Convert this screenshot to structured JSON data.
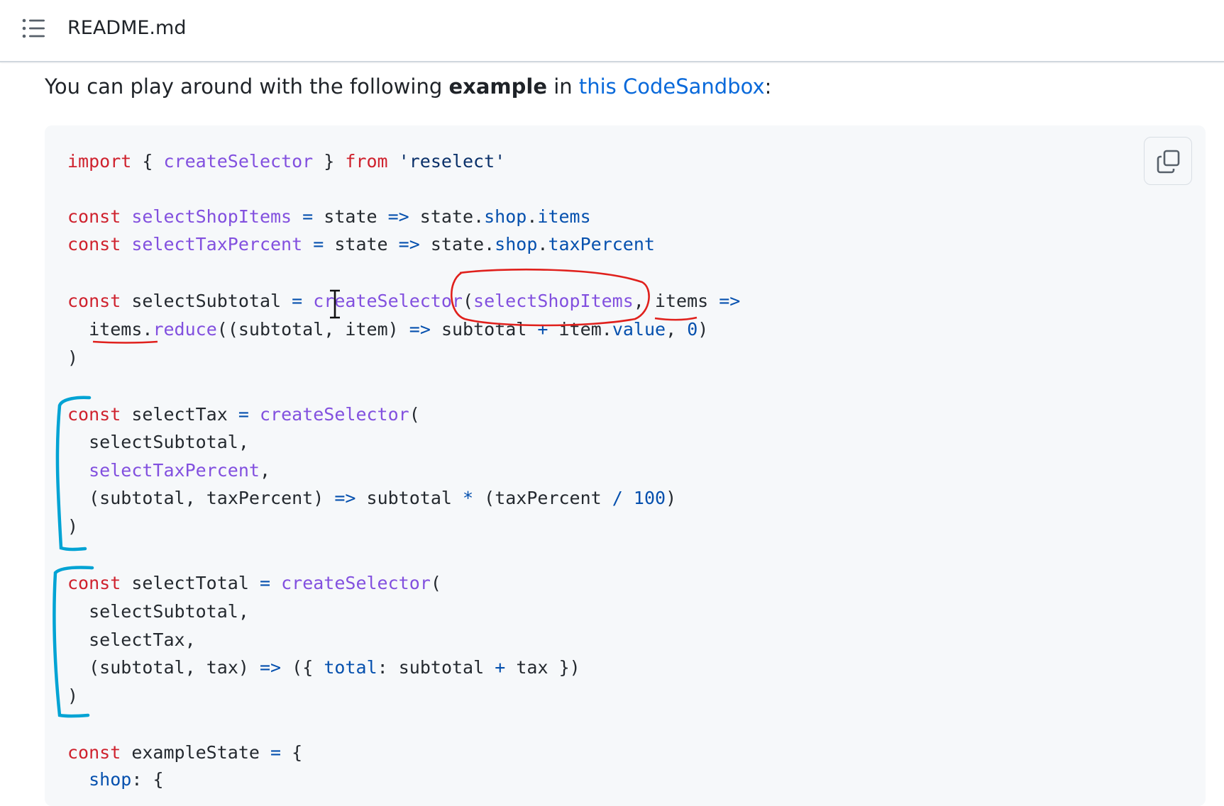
{
  "header": {
    "filename": "README.md",
    "toc_icon": "list-unordered-icon"
  },
  "intro": {
    "text_before": "You can play around with the following ",
    "bold": "example",
    "text_middle": " in ",
    "link": "this CodeSandbox",
    "text_after": ":"
  },
  "code": {
    "copy_icon": "copy-icon",
    "lines": [
      "import { createSelector } from 'reselect'",
      "",
      "const selectShopItems = state => state.shop.items",
      "const selectTaxPercent = state => state.shop.taxPercent",
      "",
      "const selectSubtotal = createSelector(selectShopItems, items =>",
      "  items.reduce((subtotal, item) => subtotal + item.value, 0)",
      ")",
      "",
      "const selectTax = createSelector(",
      "  selectSubtotal,",
      "  selectTaxPercent,",
      "  (subtotal, taxPercent) => subtotal * (taxPercent / 100)",
      ")",
      "",
      "const selectTotal = createSelector(",
      "  selectSubtotal,",
      "  selectTax,",
      "  (subtotal, tax) => ({ total: subtotal + tax })",
      ")",
      "",
      "const exampleState = {",
      "  shop: {"
    ]
  },
  "colors": {
    "keyword": "#cf222e",
    "function": "#8250df",
    "property": "#0550ae",
    "annotation_red": "#e0201c",
    "annotation_cyan": "#00a3d4"
  }
}
